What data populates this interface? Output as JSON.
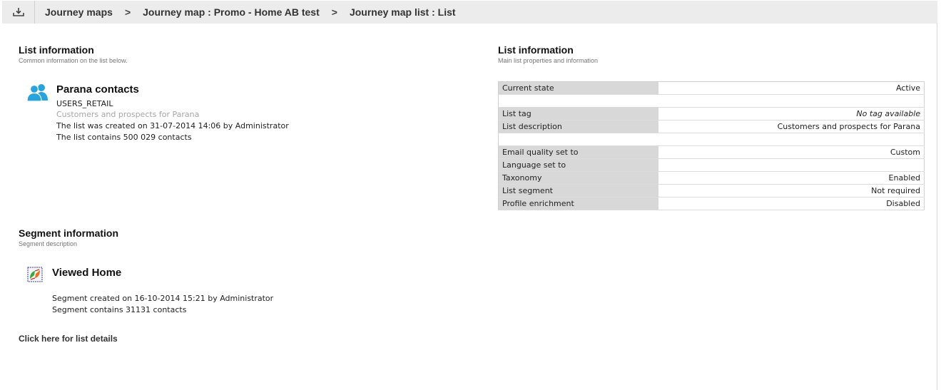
{
  "breadcrumb": {
    "items": [
      "Journey maps",
      "Journey map : Promo - Home AB test",
      "Journey map list : List"
    ],
    "separator": ">"
  },
  "left": {
    "list_section": {
      "title": "List information",
      "subtitle": "Common information on the list below.",
      "icon": "contacts-icon",
      "name": "Parana contacts",
      "code": "USERS_RETAIL",
      "description": "Customers and prospects for Parana",
      "created": "The list was created on 31-07-2014 14:06 by Administrator",
      "contains": "The list contains 500 029 contacts"
    },
    "segment_section": {
      "title": "Segment information",
      "subtitle": "Segment description",
      "icon": "segment-icon",
      "name": "Viewed Home",
      "created": "Segment created on 16-10-2014 15:21 by Administrator",
      "contains": "Segment contains 31131 contacts"
    },
    "details_link": "Click here for list details"
  },
  "right": {
    "title": "List information",
    "subtitle": "Main list properties and information",
    "rows": [
      {
        "label": "Current state",
        "value": "Active"
      },
      {
        "label": "",
        "value": ""
      },
      {
        "label": "List tag",
        "value": "No tag available"
      },
      {
        "label": "List description",
        "value": "Customers and prospects for Parana"
      },
      {
        "label": "",
        "value": ""
      },
      {
        "label": "Email quality set to",
        "value": "Custom"
      },
      {
        "label": "Language set to",
        "value": ""
      },
      {
        "label": "Taxonomy",
        "value": "Enabled"
      },
      {
        "label": "List segment",
        "value": "Not required"
      },
      {
        "label": "Profile enrichment",
        "value": "Disabled"
      }
    ]
  },
  "colors": {
    "header_bg": "#ececec",
    "label_cell_bg": "#d8d8d8",
    "contacts_icon": "#29a3db",
    "muted_text": "#a6a6a6"
  }
}
